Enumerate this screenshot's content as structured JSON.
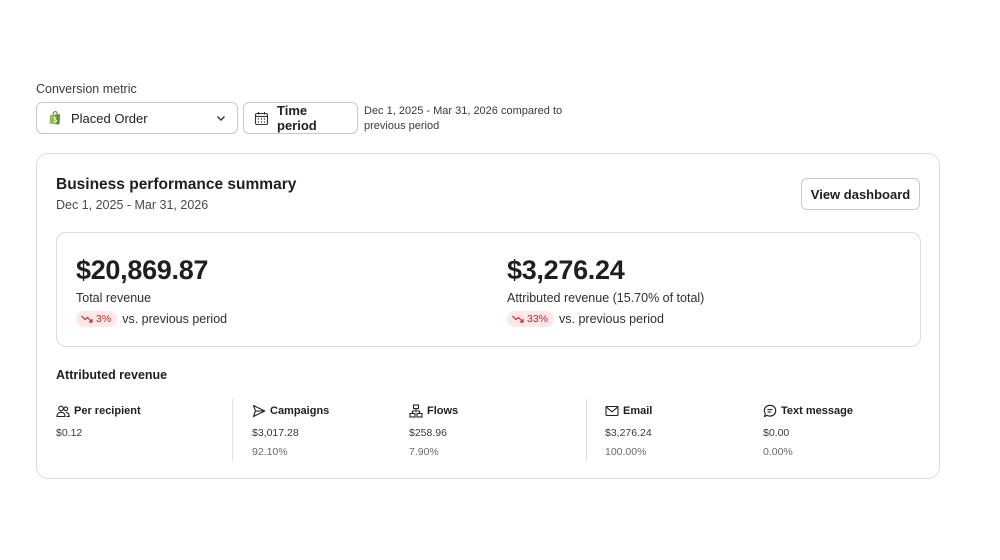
{
  "conversion": {
    "label": "Conversion metric",
    "selected": "Placed Order",
    "time_button": "Time period",
    "period_description": "Dec 1, 2025 - Mar 31, 2026 compared to previous period"
  },
  "summary": {
    "title": "Business performance summary",
    "date_range": "Dec 1, 2025 - Mar 31, 2026",
    "view_button": "View dashboard",
    "total": {
      "value": "$20,869.87",
      "label": "Total revenue",
      "change": "3%",
      "change_text": "vs. previous period"
    },
    "attributed": {
      "value": "$3,276.24",
      "label": "Attributed revenue (15.70% of total)",
      "change": "33%",
      "change_text": "vs. previous period"
    }
  },
  "attributed_revenue": {
    "title": "Attributed revenue",
    "columns": [
      {
        "icon": "people-icon",
        "label": "Per recipient",
        "value": "$0.12",
        "pct": ""
      },
      {
        "icon": "send-icon",
        "label": "Campaigns",
        "value": "$3,017.28",
        "pct": "92.10%"
      },
      {
        "icon": "flow-icon",
        "label": "Flows",
        "value": "$258.96",
        "pct": "7.90%"
      },
      {
        "icon": "mail-icon",
        "label": "Email",
        "value": "$3,276.24",
        "pct": "100.00%"
      },
      {
        "icon": "chat-icon",
        "label": "Text message",
        "value": "$0.00",
        "pct": "0.00%"
      }
    ]
  },
  "colors": {
    "decline_badge_bg": "#fde7e7",
    "decline_badge_text": "#c22a2a",
    "shopify_green": "#5e8e3e"
  }
}
